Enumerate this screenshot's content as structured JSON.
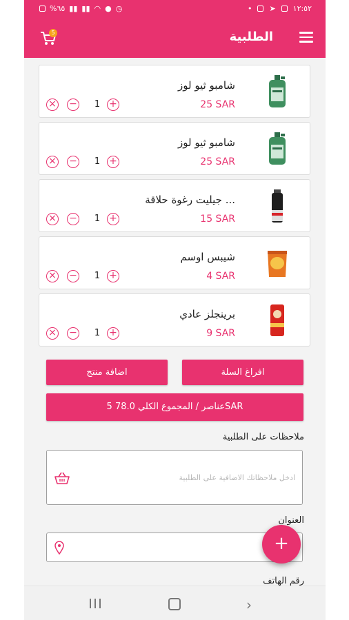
{
  "status_bar": {
    "time": "١٢:٥٢",
    "battery": "%٦٥",
    "left_icons": [
      "battery-icon",
      "signal-icon",
      "signal-icon",
      "wifi-icon",
      "location-icon",
      "alarm-icon"
    ],
    "right_icons": [
      "dot-icon",
      "monitor-icon",
      "telegram-icon",
      "image-icon"
    ]
  },
  "header": {
    "title": "الطلبية",
    "cart_count": "5",
    "accent_color": "#e8326f"
  },
  "items": [
    {
      "name": "شامبو ثيو لوز",
      "price": "25 SAR",
      "qty": "1",
      "image": "shampoo-bottle"
    },
    {
      "name": "شامبو ثيو لوز",
      "price": "25 SAR",
      "qty": "1",
      "image": "shampoo-bottle"
    },
    {
      "name": "جيليت رغوة حلاقة ...",
      "price": "15 SAR",
      "qty": "1",
      "image": "shaving-foam-can"
    },
    {
      "name": "شيبس اوسم",
      "price": "4 SAR",
      "qty": "1",
      "image": "chips-bag"
    },
    {
      "name": "برينجلز عادي",
      "price": "9 SAR",
      "qty": "1",
      "image": "pringles-can"
    }
  ],
  "actions": {
    "empty_cart": "افراغ السلة",
    "add_product": "اضافة منتج",
    "total": "5 عناصر  /  المجموع الكلي 78.0SAR"
  },
  "notes": {
    "label": "ملاحظات على الطلبية",
    "placeholder": "ادخل ملاحظاتك الاضافية على الطلبية"
  },
  "address": {
    "label": "العنوان"
  },
  "phone": {
    "label": "رقم الهاتف"
  },
  "fab": {
    "label": "+"
  }
}
